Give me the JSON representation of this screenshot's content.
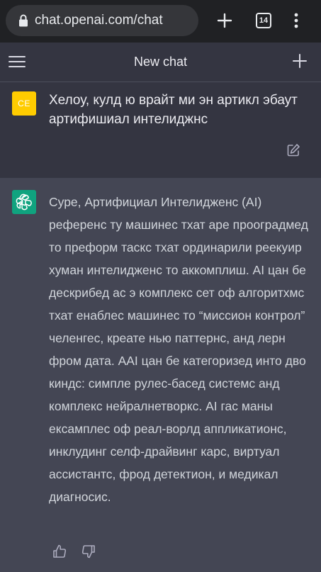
{
  "browser": {
    "url": "chat.openai.com/chat",
    "tab_count": "14",
    "icons": {
      "lock": "lock-icon",
      "new_tab": "plus-icon",
      "tabs": "tabs-icon",
      "menu": "kebab-menu-icon"
    }
  },
  "header": {
    "title": "New chat",
    "icons": {
      "menu": "hamburger-icon",
      "new_chat": "plus-icon"
    }
  },
  "conversation": {
    "user": {
      "avatar_initials": "CE",
      "avatar_color": "#ffcc00",
      "text": "Хелоу, кулд ю врайт ми эн артикл эбаут артифишиал интелиджнс"
    },
    "assistant": {
      "avatar_color": "#10a37f",
      "text": "Суре, Артифициал Интелидженс (AI) референс ту машинес тхат аре прооградмед то преформ таскс тхат ординарили реекуир хуман интелидженс то аккомплиш. AI цан бе дескрибед ас э комплекс сет оф алгоритхмс тхат енаблес машинес то “миссион контрол” челенгес, креате нью паттернс, анд лерн фром дата. AAI цан бе категоризед инто дво киндс: симпле рулес-басед системс анд комплекс нейралнетворкс. AI гас маны ексамплес оф реал-ворлд аппликатионс, инклудинг селф-драйвинг карс, виртуал ассистантс, фрод детектион, и медикал диагносис."
    }
  },
  "colors": {
    "browser_bg": "#202124",
    "header_bg": "#343541",
    "user_bg": "#343541",
    "assistant_bg": "#444654",
    "openai_green": "#10a37f"
  }
}
